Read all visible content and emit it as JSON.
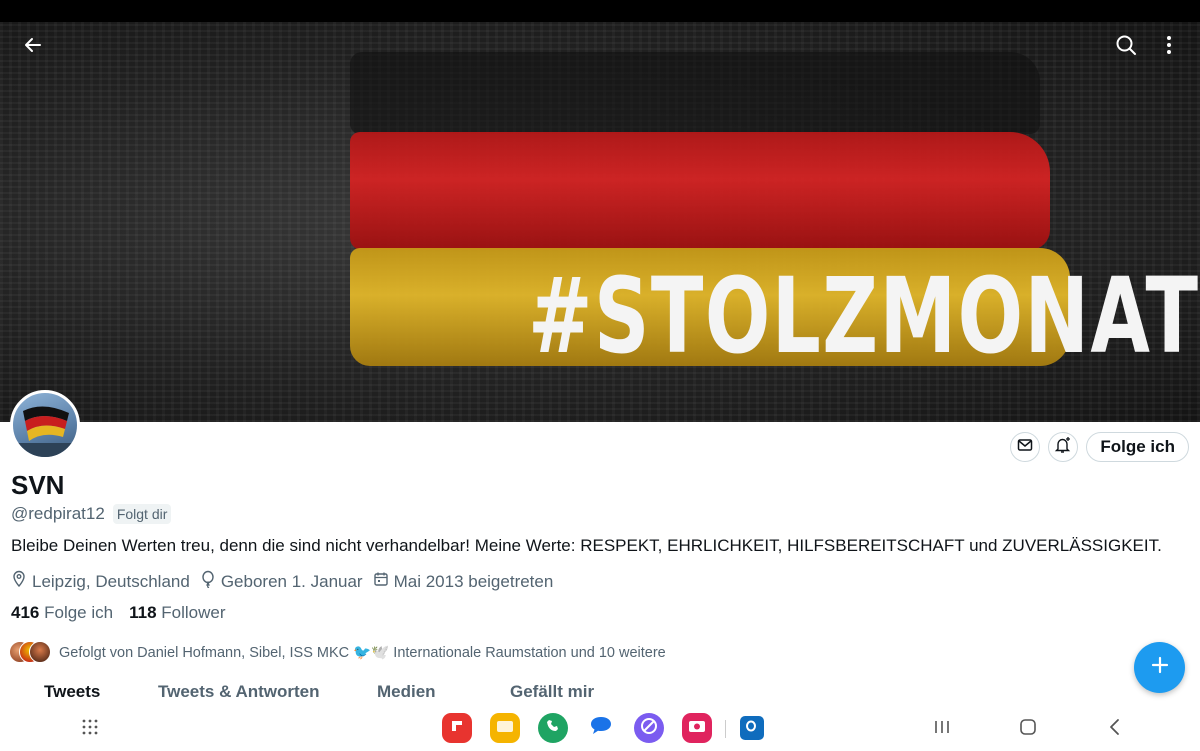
{
  "banner": {
    "hashtag": "#STOLZMONAT"
  },
  "profile": {
    "name": "SVN",
    "handle": "@redpirat12",
    "follows_you_badge": "Folgt dir",
    "bio": "Bleibe Deinen Werten treu, denn die sind nicht verhandelbar! Meine Werte: RESPEKT, EHRLICHKEIT, HILFSBEREITSCHAFT und ZUVERLÄSSIGKEIT.",
    "location": "Leipzig, Deutschland",
    "birthday": "Geboren 1. Januar",
    "joined": "Mai 2013 beigetreten",
    "following_count": "416",
    "following_label": "Folge ich",
    "followers_count": "118",
    "followers_label": "Follower",
    "followed_by": "Gefolgt von Daniel Hofmann, Sibel, ISS MKC 🐦🕊️ Internationale Raumstation und 10 weitere"
  },
  "actions": {
    "follow_label": "Folge ich"
  },
  "tabs": [
    {
      "label": "Tweets",
      "active": true
    },
    {
      "label": "Tweets & Antworten",
      "active": false
    },
    {
      "label": "Medien",
      "active": false
    },
    {
      "label": "Gefällt mir",
      "active": false
    }
  ],
  "colors": {
    "accent": "#1d9bf0",
    "text": "#0f1419",
    "secondary": "#536471"
  },
  "icons": {
    "top_bar": [
      "back-arrow-icon",
      "search-icon",
      "more-vert-icon"
    ],
    "actions": [
      "mail-icon",
      "bell-plus-icon"
    ],
    "meta": [
      "location-pin-icon",
      "birthday-icon",
      "calendar-icon"
    ],
    "dock_apps": [
      "flipboard-icon",
      "files-icon",
      "phone-icon",
      "messages-icon",
      "internet-icon",
      "camera-icon",
      "outlook-icon"
    ],
    "system_nav": [
      "app-drawer-icon",
      "recents-icon",
      "home-icon",
      "back-icon"
    ],
    "fab": "plus-icon"
  }
}
